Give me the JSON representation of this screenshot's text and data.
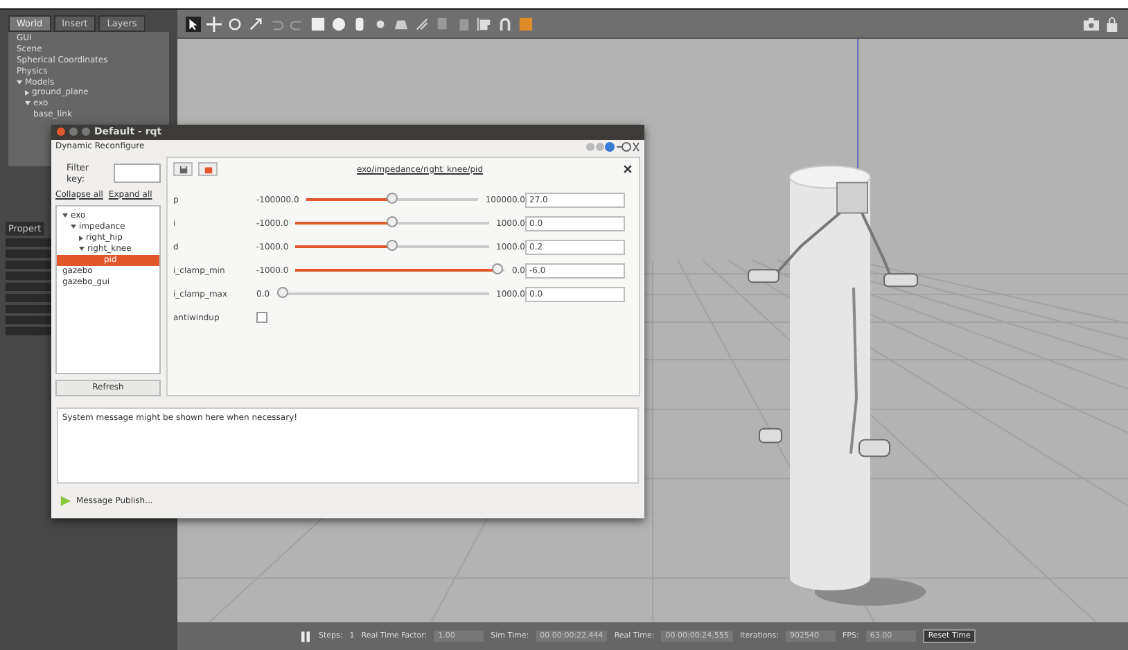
{
  "gazebo": {
    "left_panel": {
      "tabs": [
        {
          "label": "World",
          "selected": true
        },
        {
          "label": "Insert",
          "selected": false
        },
        {
          "label": "Layers",
          "selected": false
        }
      ],
      "tree": [
        {
          "label": "GUI"
        },
        {
          "label": "Scene"
        },
        {
          "label": "Spherical Coordinates"
        },
        {
          "label": "Physics"
        },
        {
          "label": "Models",
          "expanded": true,
          "children": [
            {
              "label": "ground_plane",
              "expanded": false
            },
            {
              "label": "exo",
              "expanded": true,
              "children": [
                {
                  "label": "base_link"
                }
              ]
            }
          ]
        }
      ],
      "property_header": "Propert"
    },
    "status_bar": {
      "steps_label": "Steps:",
      "steps": "1",
      "fields": [
        {
          "label": "Real Time Factor:",
          "value": "1.00"
        },
        {
          "label": "Sim Time:",
          "value": "00 00:00:22.444"
        },
        {
          "label": "Real Time:",
          "value": "00 00:00:24.555"
        },
        {
          "label": "Iterations:",
          "value": "902540"
        },
        {
          "label": "FPS:",
          "value": "63.00"
        }
      ],
      "reset_button": "Reset Time"
    }
  },
  "rqt": {
    "window_title": "Default - rqt",
    "plugin_title": "Dynamic Reconfigure",
    "filter_label": "Filter key:",
    "collapse_link": "Collapse all",
    "expand_link": "Expand all",
    "tree": [
      {
        "label": "exo",
        "expanded": true,
        "selected": false,
        "children": [
          {
            "label": "impedance",
            "expanded": true,
            "selected": false,
            "children": [
              {
                "label": "right_hip",
                "expanded": false,
                "selected": false
              },
              {
                "label": "right_knee",
                "expanded": true,
                "selected": false,
                "children": [
                  {
                    "label": "pid",
                    "selected": true
                  }
                ]
              }
            ]
          }
        ]
      },
      {
        "label": "gazebo",
        "selected": false
      },
      {
        "label": "gazebo_gui",
        "selected": false
      }
    ],
    "refresh_button": "Refresh",
    "node_path": "exo/impedance/right_knee/pid",
    "params": [
      {
        "kind": "slider",
        "name": "p",
        "min": "-100000.0",
        "max": "100000.0",
        "value": "27.0",
        "level": 0.5
      },
      {
        "kind": "slider",
        "name": "i",
        "min": "-1000.0",
        "max": "1000.0",
        "value": "0.0",
        "level": 0.5
      },
      {
        "kind": "slider",
        "name": "d",
        "min": "-1000.0",
        "max": "1000.0",
        "value": "0.2",
        "level": 0.5
      },
      {
        "kind": "slider",
        "name": "i_clamp_min",
        "min": "-1000.0",
        "max": "0.0",
        "value": "-6.0",
        "level": 0.99
      },
      {
        "kind": "slider",
        "name": "i_clamp_max",
        "min": "0.0",
        "max": "1000.0",
        "value": "0.0",
        "level": 0
      },
      {
        "kind": "checkbox",
        "name": "antiwindup",
        "checked": false
      }
    ],
    "message": "System message might be shown here when necessary!",
    "publish_label": "Message Publish..."
  }
}
